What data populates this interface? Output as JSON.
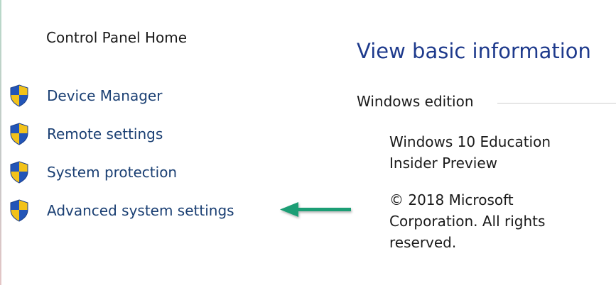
{
  "sidebar": {
    "home_link": "Control Panel Home",
    "items": [
      {
        "label": "Device Manager",
        "icon": "uac-shield-icon"
      },
      {
        "label": "Remote settings",
        "icon": "uac-shield-icon"
      },
      {
        "label": "System protection",
        "icon": "uac-shield-icon"
      },
      {
        "label": "Advanced system settings",
        "icon": "uac-shield-icon"
      }
    ]
  },
  "annotation": {
    "arrow_color": "#1f9e74",
    "icon": "left-arrow-icon"
  },
  "main": {
    "heading": "View basic information",
    "section_title": "Windows edition",
    "edition_line1": "Windows 10 Education",
    "edition_line2": "Insider Preview",
    "copyright_line1": "© 2018 Microsoft",
    "copyright_line2": "Corporation. All rights",
    "copyright_line3": "reserved."
  },
  "colors": {
    "link_blue": "#1a3f73",
    "heading_blue": "#1e3a8c",
    "shield_blue": "#2255b8",
    "shield_yellow": "#f2c21a"
  }
}
